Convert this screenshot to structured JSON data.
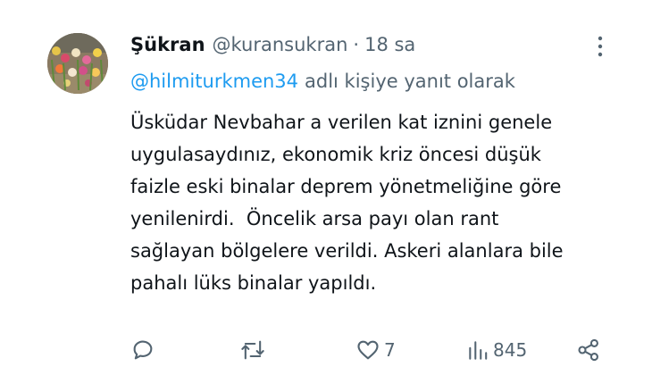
{
  "tweet": {
    "display_name": "Şükran",
    "handle": "@kuransukran",
    "separator": "·",
    "time": "18 sa",
    "reply": {
      "mention": "@hilmiturkmen34",
      "suffix": "adlı kişiye yanıt olarak"
    },
    "body_lines": [
      "Üsküdar Nevbahar a verilen kat iznini genele",
      "uygulasaydınız, ekonomik kriz öncesi düşük",
      "faizle eski binalar deprem yönetmeliğine göre",
      "yenilenirdi.  Öncelik arsa payı olan rant",
      "sağlayan bölgelere verildi. Askeri alanlara bile",
      "pahalı lüks binalar yapıldı."
    ],
    "actions": {
      "reply_icon": "reply-icon",
      "retweet_icon": "retweet-icon",
      "like_icon": "heart-icon",
      "like_count": "7",
      "views_icon": "bar-chart-icon",
      "views_count": "845",
      "share_icon": "share-icon"
    }
  },
  "colors": {
    "text": "#0f1419",
    "secondary": "#536471",
    "link": "#1d9bf0"
  }
}
